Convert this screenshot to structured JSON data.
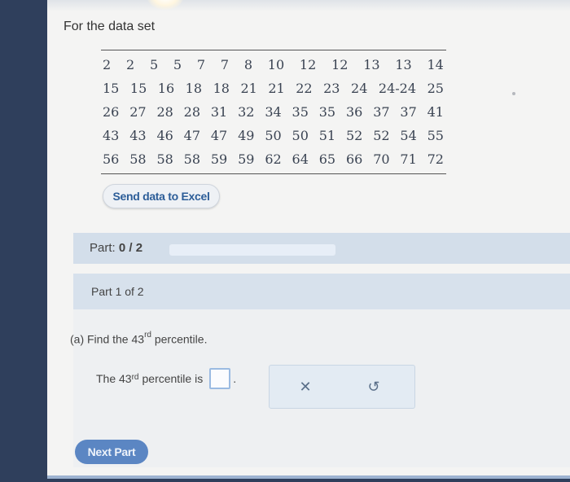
{
  "intro": "For the data set",
  "data_rows": [
    [
      "2",
      "2",
      "5",
      "5",
      "7",
      "7",
      "8",
      "10",
      "12",
      "12",
      "13",
      "13",
      "14"
    ],
    [
      "15",
      "15",
      "16",
      "18",
      "18",
      "21",
      "21",
      "22",
      "23",
      "24",
      "24-24",
      "25"
    ],
    [
      "26",
      "27",
      "28",
      "28",
      "31",
      "32",
      "34",
      "35",
      "35",
      "36",
      "37",
      "37",
      "41"
    ],
    [
      "43",
      "43",
      "46",
      "47",
      "47",
      "49",
      "50",
      "50",
      "51",
      "52",
      "52",
      "54",
      "55"
    ],
    [
      "56",
      "58",
      "58",
      "58",
      "59",
      "59",
      "62",
      "64",
      "65",
      "66",
      "70",
      "71",
      "72"
    ]
  ],
  "excel_button": "Send data to Excel",
  "part": {
    "label": "Part:",
    "value": "0 / 2",
    "progress": 0
  },
  "panel": {
    "title": "Part 1 of 2"
  },
  "question": {
    "prefix": "(a) Find the 43",
    "sup": "rd",
    "suffix": "percentile."
  },
  "answer": {
    "prefix": "The 43",
    "sup": "rd",
    "suffix": "percentile is",
    "value": "",
    "period": "."
  },
  "tools": {
    "clear_icon": "close-icon",
    "clear_glyph": "✕",
    "undo_icon": "undo-icon",
    "undo_glyph": "↺"
  },
  "next_button": "Next Part",
  "colors": {
    "accent": "#5b86c3",
    "part_bar": "#d3deea",
    "input_border": "#9bbbe2"
  }
}
